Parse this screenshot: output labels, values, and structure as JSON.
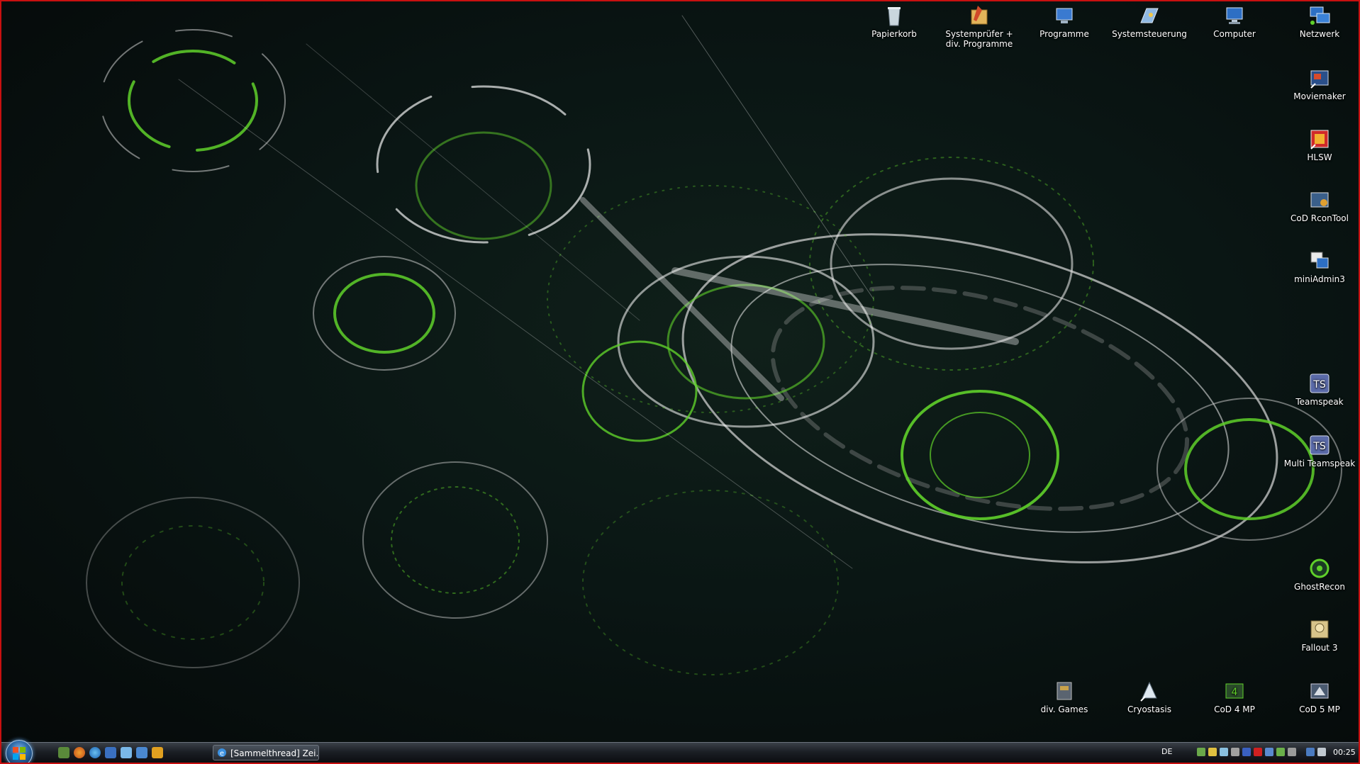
{
  "desktop": {
    "icons_top": [
      {
        "id": "papierkorb",
        "label": "Papierkorb",
        "icon": "recycle-bin-icon"
      },
      {
        "id": "systempruefer",
        "label": "Systemprüfer + div. Programme",
        "icon": "tools-folder-icon"
      },
      {
        "id": "programme",
        "label": "Programme",
        "icon": "computer-folder-icon"
      },
      {
        "id": "systemsteuerung",
        "label": "Systemsteuerung",
        "icon": "control-panel-icon"
      },
      {
        "id": "computer",
        "label": "Computer",
        "icon": "computer-icon"
      },
      {
        "id": "netzwerk",
        "label": "Netzwerk",
        "icon": "network-icon"
      }
    ],
    "icons_right": [
      {
        "id": "moviemaker",
        "label": "Moviemaker",
        "icon": "moviemaker-icon"
      },
      {
        "id": "hlsw",
        "label": "HLSW",
        "icon": "hlsw-icon"
      },
      {
        "id": "cod-rcontool",
        "label": "CoD RconTool",
        "icon": "rcon-tool-icon"
      },
      {
        "id": "miniadmin3",
        "label": "miniAdmin3",
        "icon": "miniadmin-icon"
      },
      {
        "id": "teamspeak",
        "label": "Teamspeak",
        "icon": "teamspeak-icon"
      },
      {
        "id": "multi-teamspeak",
        "label": "Multi Teamspeak",
        "icon": "teamspeak-icon"
      },
      {
        "id": "ghostrecon",
        "label": "GhostRecon",
        "icon": "ghostrecon-icon"
      },
      {
        "id": "fallout3",
        "label": "Fallout 3",
        "icon": "fallout-icon"
      }
    ],
    "icons_bottom": [
      {
        "id": "div-games",
        "label": "div. Games",
        "icon": "games-folder-icon"
      },
      {
        "id": "cryostasis",
        "label": "Cryostasis",
        "icon": "cryostasis-icon"
      },
      {
        "id": "cod4mp",
        "label": "CoD 4 MP",
        "icon": "cod4-icon"
      },
      {
        "id": "cod5mp",
        "label": "CoD 5 MP",
        "icon": "cod5-icon"
      }
    ]
  },
  "taskbar": {
    "quick_launch": [
      "show-desktop-icon",
      "firefox-icon",
      "ie-icon",
      "explorer-icon",
      "messenger-icon",
      "media-icon",
      "window-switch-icon"
    ],
    "task_button_label": "[Sammelthread] Zei...",
    "language": "DE",
    "clock": "00:25"
  },
  "colors": {
    "accent_green": "#5fd02a",
    "frame_red": "#c81010",
    "taskbar": "#1b1f25"
  }
}
